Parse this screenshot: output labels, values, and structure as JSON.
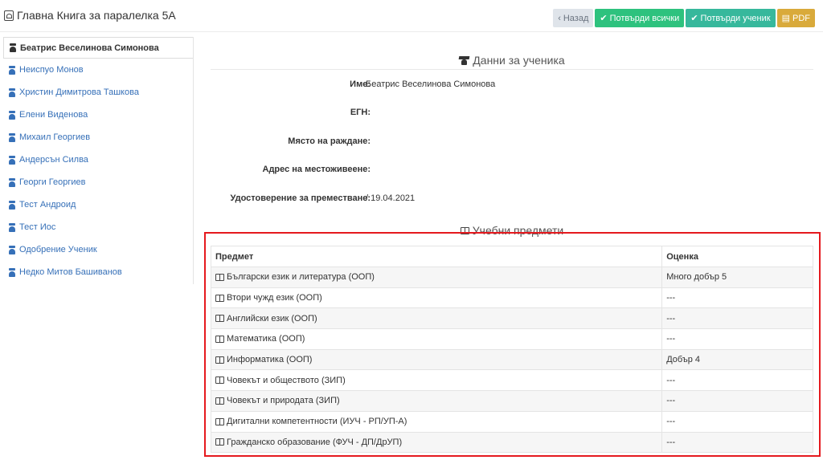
{
  "header": {
    "title": "Главна Книга за паралелка 5А",
    "buttons": {
      "back": "Назад",
      "confirm_all": "Потвърди всички",
      "confirm_student": "Потвърди ученик",
      "pdf": "PDF"
    }
  },
  "sidebar": {
    "items": [
      {
        "label": "Беатрис Веселинова Симонова",
        "active": true
      },
      {
        "label": "Неиспуо Монов"
      },
      {
        "label": "Христин Димитрова Ташкова"
      },
      {
        "label": "Елени Виденова"
      },
      {
        "label": "Михаил Георгиев"
      },
      {
        "label": "Андерсън Силва"
      },
      {
        "label": "Георги Георгиев"
      },
      {
        "label": "Тест Андроид"
      },
      {
        "label": "Тест Иос"
      },
      {
        "label": "Одобрение Ученик"
      },
      {
        "label": "Недко Митов Башиванов"
      }
    ]
  },
  "student": {
    "section_title": "Данни за ученика",
    "fields": [
      {
        "label": "Име:",
        "value": "Беатрис Веселинова Симонова"
      },
      {
        "label": "ЕГН:",
        "value": ""
      },
      {
        "label": "Място на раждане:",
        "value": ""
      },
      {
        "label": "Адрес на местоживеене:",
        "value": ""
      },
      {
        "label": "Удостоверение за преместване:",
        "value": "/ 19.04.2021"
      }
    ]
  },
  "subjects": {
    "section_title": "Учебни предмети",
    "headers": {
      "subject": "Предмет",
      "grade": "Оценка"
    },
    "rows": [
      {
        "subject": "Български език и литература (ООП)",
        "grade": "Много добър 5"
      },
      {
        "subject": "Втори чужд език (ООП)",
        "grade": "---"
      },
      {
        "subject": "Английски език (ООП)",
        "grade": "---"
      },
      {
        "subject": "Математика (ООП)",
        "grade": "---"
      },
      {
        "subject": "Информатика (ООП)",
        "grade": "Добър 4"
      },
      {
        "subject": "Човекът и обществото (ЗИП)",
        "grade": "---"
      },
      {
        "subject": "Човекът и природата (ЗИП)",
        "grade": "---"
      },
      {
        "subject": "Дигитални компетентности (ИУЧ - РП/УП-А)",
        "grade": "---"
      },
      {
        "subject": "Гражданско образование (ФУЧ - ДП/ДрУП)",
        "grade": "---"
      }
    ]
  },
  "colors": {
    "link": "#3670b8",
    "green": "#2ec27e",
    "teal": "#37b89c",
    "pdf": "#d9aa3b",
    "highlight": "#e5191e"
  }
}
